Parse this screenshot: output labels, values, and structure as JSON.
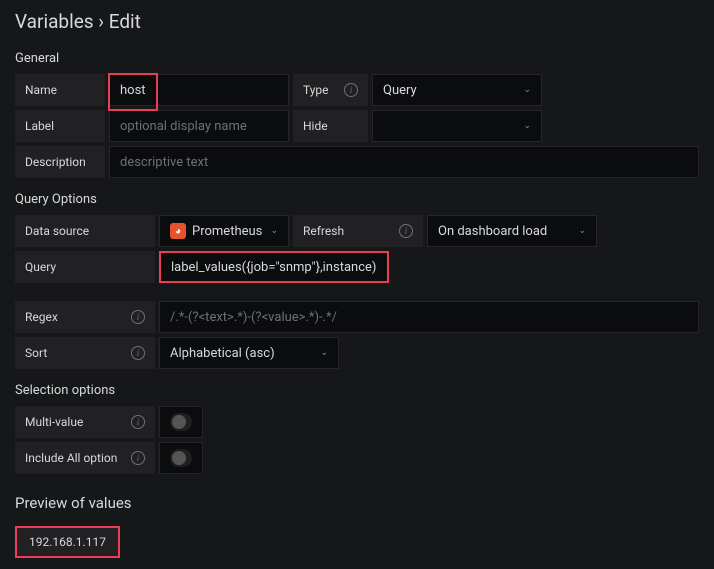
{
  "pageTitle": "Variables › Edit",
  "sections": {
    "general": "General",
    "queryOptions": "Query Options",
    "selectionOptions": "Selection options",
    "preview": "Preview of values"
  },
  "labels": {
    "name": "Name",
    "type": "Type",
    "label": "Label",
    "hide": "Hide",
    "description": "Description",
    "dataSource": "Data source",
    "refresh": "Refresh",
    "query": "Query",
    "regex": "Regex",
    "sort": "Sort",
    "multiValue": "Multi-value",
    "includeAll": "Include All option"
  },
  "fields": {
    "name": "host",
    "type": "Query",
    "labelPlaceholder": "optional display name",
    "hide": "",
    "descriptionPlaceholder": "descriptive text",
    "dataSource": "Prometheus",
    "refresh": "On dashboard load",
    "query": "label_values({job=\"snmp\"},instance)",
    "regexPlaceholder": "/.*-(?<text>.*)-(?<value>.*)-.*/",
    "sort": "Alphabetical (asc)",
    "multiValue": false,
    "includeAll": false
  },
  "preview": {
    "values": [
      "192.168.1.117"
    ]
  }
}
